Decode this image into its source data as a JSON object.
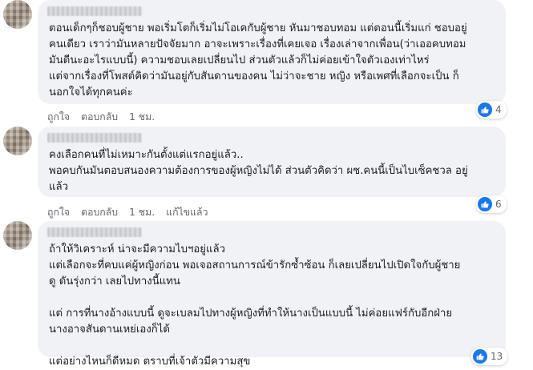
{
  "comments": [
    {
      "text": "ตอนเด็กๆก็ชอบผู้ชาย พอเริ่มโตก็เริ่มไม่โอเคกับผู้ชาย หันมาชอบทอม แต่ตอนนี้เริ่มแก่ ชอบอยู่\nคนเดียว เราว่ามันหลายปัจจัยมาก อาจะเพราะเรื่องที่เคยเจอ เรื่องเล่าจากเพื่อน(ว่าเออคบทอม\nมันดีนะอะไรแบบนี้) ความชอบเลยเปลี่ยนไป ส่วนตัวแล้วก็ไม่ค่อยเข้าใจตัวเองเท่าไหร่\nแต่จากเรื่องที่โพสต์คิดว่ามันอยู่กับสันดานของคน ไม่ว่าจะชาย หญิง หรือเพศที่เลือกจะเป็น ก็\nนอกใจได้ทุกคนค่ะ",
      "like_label": "ถูกใจ",
      "reply_label": "ตอบกลับ",
      "time": "1 ชม.",
      "reaction_count": "4",
      "reaction_icon": "like-icon"
    },
    {
      "text": "คงเลือกคนที่ไม่เหมาะกันตั้งแต่แรกอยู่แล้ว..\nพอคบกันมันตอบสนองความต้องการของผู้หญิงไม่ได้ ส่วนตัวคิดว่า ผช.คนนี้เป็นไบเซ็คชวล อยู่\nแล้ว",
      "like_label": "ถูกใจ",
      "reply_label": "ตอบกลับ",
      "time": "1 ชม.",
      "edited_label": "แก้ไขแล้ว",
      "reaction_count": "6",
      "reaction_icon": "like-icon"
    },
    {
      "text": "ถ้าให้วิเคราะห์ น่าจะมีความไบฯอยู่แล้ว\nแต่เลือกจะที่คบแค่ผู้หญิงก่อน พอเจอสถานการณ์ข้ารักซ้ำซ้อน ก็เลยเปลี่ยนไปเปิดใจกับผู้ชาย\nดู ดันรุ่งกว่า เลยไปทางนี้แทน\n\nแต่ การที่นางอ้างแบบนี้ ดูจะเบลมไปทางผู้หญิงที่ทำให้นางเป็นแบบนี้ ไม่ค่อยแฟร์กับอีกฝ่าย\nนางอาจสันดานเหย่เองก็ได้\n\nแต่อย่างไหนก็ดีหมด ตราบที่เจ้าตัวมีความสุข",
      "reaction_count": "13",
      "reaction_icon": "like-icon"
    }
  ]
}
